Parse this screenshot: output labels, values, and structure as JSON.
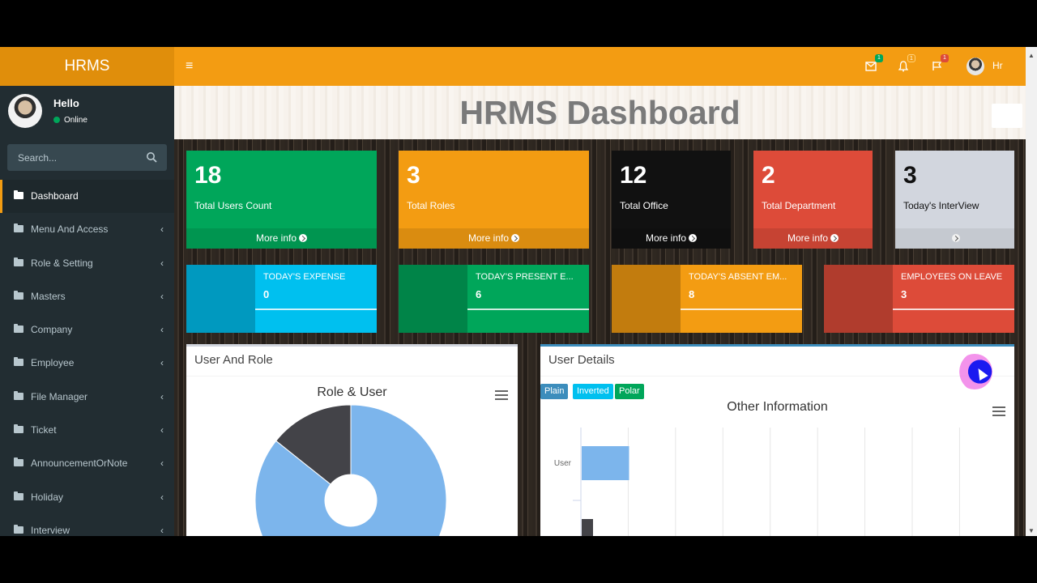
{
  "app": {
    "brand": "HRMS"
  },
  "topbar": {
    "badges": {
      "mail": "1",
      "bell": "1",
      "flag": "1"
    },
    "user_name": "Hr"
  },
  "sidebar": {
    "greeting": "Hello",
    "status": "Online",
    "search_placeholder": "Search...",
    "items": [
      {
        "label": "Dashboard"
      },
      {
        "label": "Menu And Access"
      },
      {
        "label": "Role & Setting"
      },
      {
        "label": "Masters"
      },
      {
        "label": "Company"
      },
      {
        "label": "Employee"
      },
      {
        "label": "File Manager"
      },
      {
        "label": "Ticket"
      },
      {
        "label": "AnnouncementOrNote"
      },
      {
        "label": "Holiday"
      },
      {
        "label": "Interview"
      }
    ]
  },
  "page_title": "HRMS Dashboard",
  "stats": [
    {
      "value": "18",
      "label": "Total Users Count",
      "footer": "More info",
      "color": "#00a65a"
    },
    {
      "value": "3",
      "label": "Total Roles",
      "footer": "More info",
      "color": "#f39c12"
    },
    {
      "value": "12",
      "label": "Total Office",
      "footer": "More info",
      "color": "#111111"
    },
    {
      "value": "2",
      "label": "Total Department",
      "footer": "More info",
      "color": "#dd4b39"
    },
    {
      "value": "3",
      "label": "Today's InterView",
      "footer": "",
      "color": "#d2d6de"
    }
  ],
  "info_boxes": [
    {
      "label": "TODAY'S EXPENSE",
      "value": "0",
      "color": "#00c0ef"
    },
    {
      "label": "TODAY'S PRESENT E...",
      "value": "6",
      "color": "#00a65a"
    },
    {
      "label": "TODAY'S ABSENT EM...",
      "value": "8",
      "color": "#f39c12"
    },
    {
      "label": "EMPLOYEES ON LEAVE",
      "value": "3",
      "color": "#dd4b39"
    }
  ],
  "panels": {
    "left": {
      "title": "User And Role",
      "chart_title": "Role & User"
    },
    "right": {
      "title": "User Details",
      "chart_title": "Other Information",
      "buttons": [
        "Plain",
        "Inverted",
        "Polar"
      ]
    }
  },
  "chart_data": [
    {
      "type": "pie",
      "title": "Role & User",
      "series": [
        {
          "values": [
            18,
            3
          ]
        }
      ],
      "colors": [
        "#7cb5ec",
        "#434348"
      ]
    },
    {
      "type": "bar",
      "title": "Other Information",
      "categories": [
        "User"
      ],
      "series": [
        {
          "values": [
            18
          ]
        }
      ],
      "colors": [
        "#7cb5ec",
        "#434348"
      ]
    }
  ]
}
